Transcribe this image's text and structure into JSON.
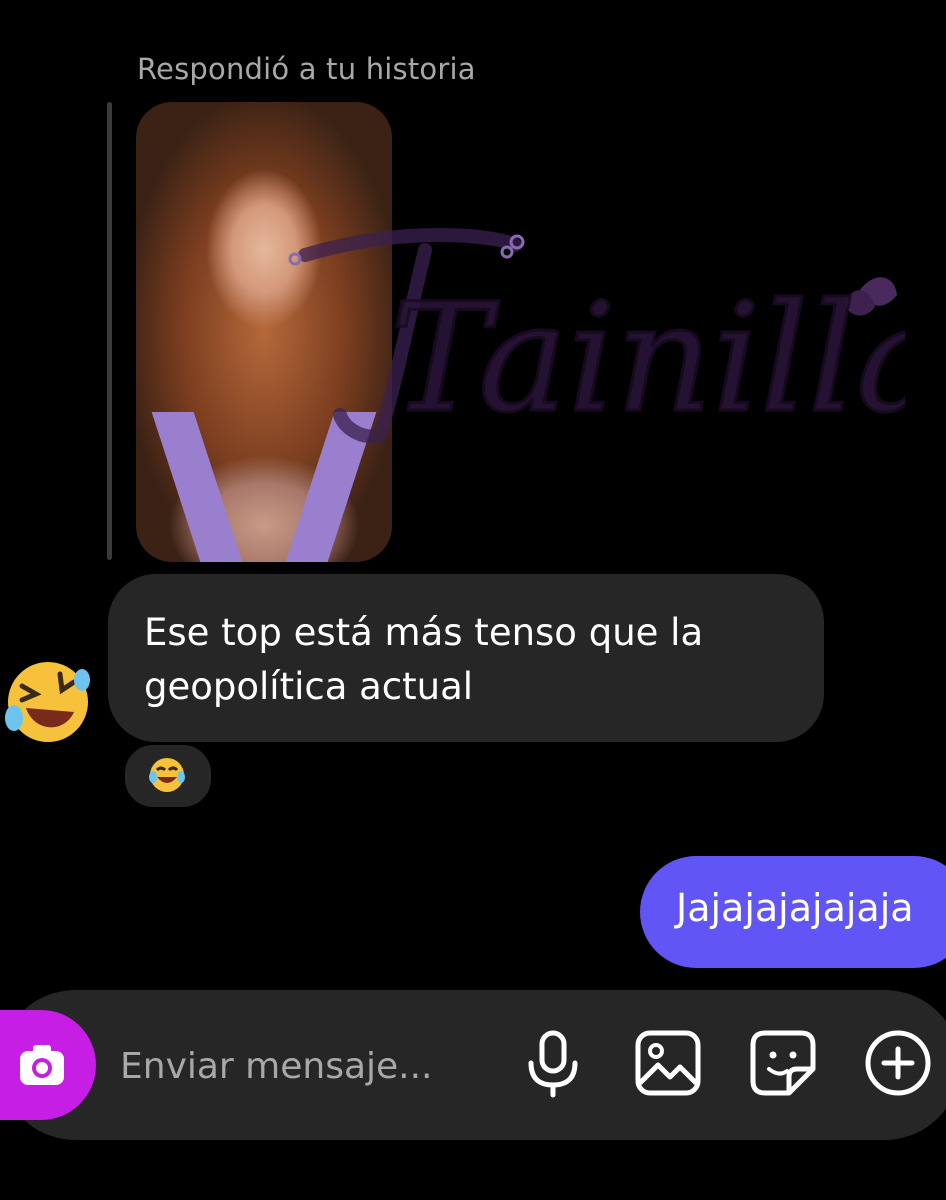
{
  "story": {
    "reply_label": "Respondió a tu historia",
    "watermark_text": "Tainilla"
  },
  "messages": {
    "incoming_text": "Ese top está más tenso que la geopolítica actual",
    "incoming_reaction_icon": "face-with-tears-of-joy-icon",
    "sender_avatar_icon": "rolling-on-floor-laughing-icon",
    "outgoing_text": "Jajajajajajaja"
  },
  "composer": {
    "placeholder": "Enviar mensaje...",
    "icons": [
      "camera-icon",
      "microphone-icon",
      "gallery-icon",
      "sticker-icon",
      "plus-icon"
    ]
  },
  "colors": {
    "background": "#000000",
    "incoming_bubble": "#262626",
    "outgoing_bubble": "#6155f5",
    "camera_button": "#c71ee6",
    "secondary_text": "#a8a8a8"
  }
}
